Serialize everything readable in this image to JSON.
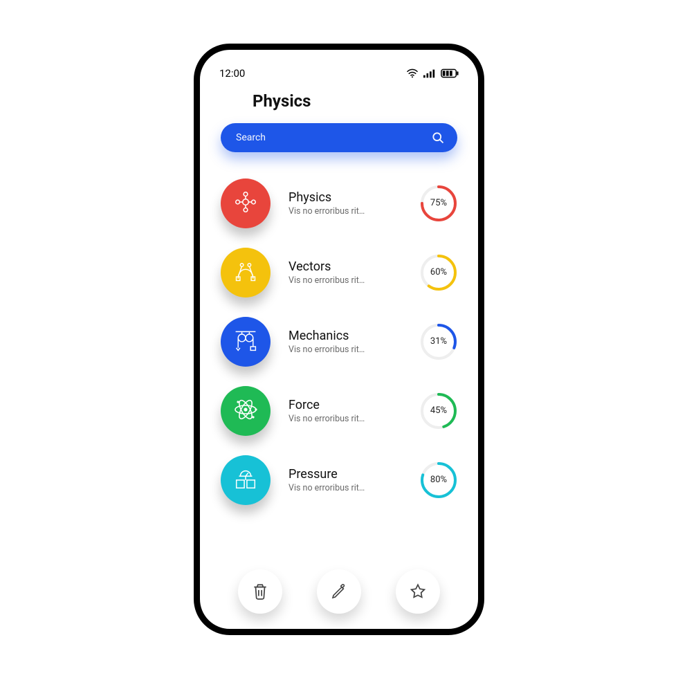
{
  "status": {
    "time": "12:00"
  },
  "page": {
    "title": "Physics"
  },
  "search": {
    "placeholder": "Search"
  },
  "colors": {
    "red": "#e8453c",
    "yellow": "#f4c20d",
    "blue": "#1e56e8",
    "green": "#1fba55",
    "cyan": "#17c1d6"
  },
  "topics": [
    {
      "title": "Physics",
      "subtitle": "Vis no erroribus rit…",
      "percent": 75,
      "color": "#e8453c",
      "icon": "molecule"
    },
    {
      "title": "Vectors",
      "subtitle": "Vis no erroribus rit…",
      "percent": 60,
      "color": "#f4c20d",
      "icon": "bezier"
    },
    {
      "title": "Mechanics",
      "subtitle": "Vis no erroribus rit…",
      "percent": 31,
      "color": "#1e56e8",
      "icon": "pulley"
    },
    {
      "title": "Force",
      "subtitle": "Vis no erroribus rit…",
      "percent": 45,
      "color": "#1fba55",
      "icon": "atom"
    },
    {
      "title": "Pressure",
      "subtitle": "Vis no erroribus rit…",
      "percent": 80,
      "color": "#17c1d6",
      "icon": "gauge"
    }
  ],
  "actions": [
    "delete",
    "edit",
    "favorite"
  ]
}
